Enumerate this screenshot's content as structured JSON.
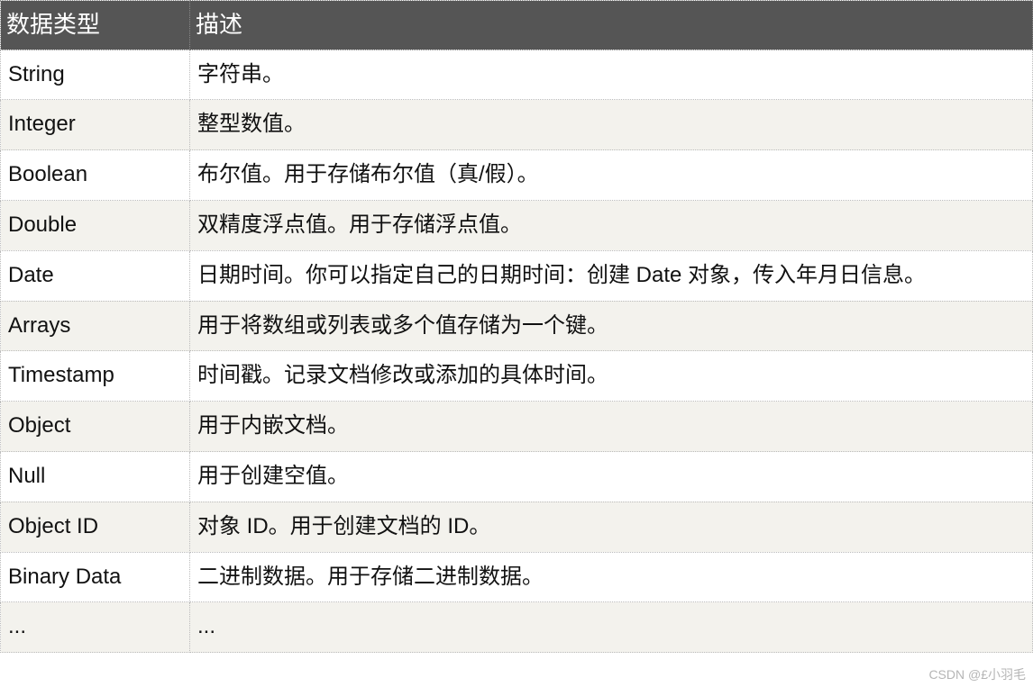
{
  "table": {
    "headers": [
      "数据类型",
      "描述"
    ],
    "rows": [
      {
        "type": "String",
        "desc": "字符串。"
      },
      {
        "type": "Integer",
        "desc": "整型数值。"
      },
      {
        "type": "Boolean",
        "desc": "布尔值。用于存储布尔值（真/假）。"
      },
      {
        "type": "Double",
        "desc": "双精度浮点值。用于存储浮点值。"
      },
      {
        "type": "Date",
        "desc": "日期时间。你可以指定自己的日期时间：创建 Date 对象，传入年月日信息。"
      },
      {
        "type": "Arrays",
        "desc": "用于将数组或列表或多个值存储为一个键。"
      },
      {
        "type": "Timestamp",
        "desc": "时间戳。记录文档修改或添加的具体时间。"
      },
      {
        "type": "Object",
        "desc": "用于内嵌文档。"
      },
      {
        "type": "Null",
        "desc": "用于创建空值。"
      },
      {
        "type": "Object ID",
        "desc": "对象 ID。用于创建文档的 ID。"
      },
      {
        "type": "Binary Data",
        "desc": "二进制数据。用于存储二进制数据。"
      },
      {
        "type": "...",
        "desc": "..."
      }
    ]
  },
  "watermark": "CSDN @£小羽毛"
}
